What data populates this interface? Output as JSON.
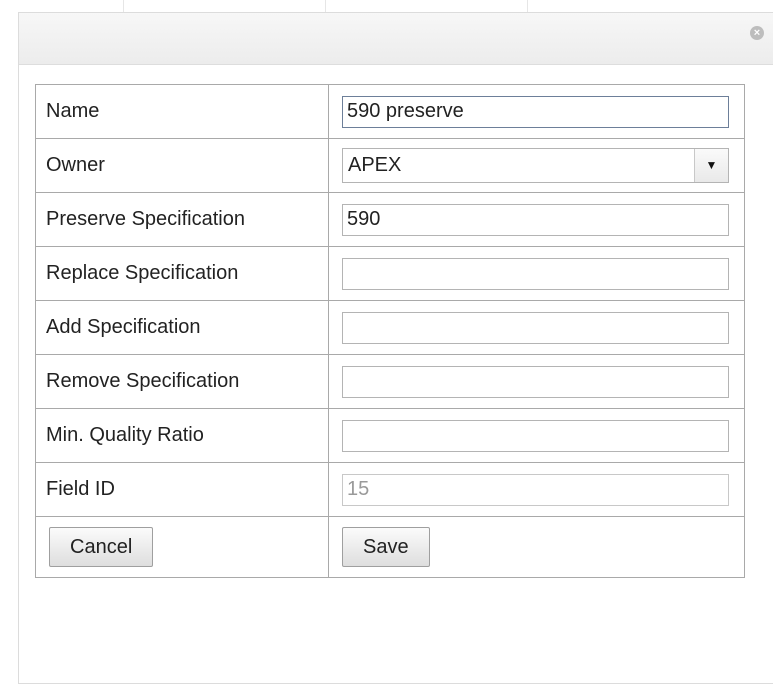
{
  "dialog": {
    "close_icon": "close-icon",
    "close_glyph": "×"
  },
  "form": {
    "fields": [
      {
        "label": "Name",
        "value": "590 preserve",
        "type": "text"
      },
      {
        "label": "Owner",
        "value": "APEX",
        "type": "select"
      },
      {
        "label": "Preserve Specification",
        "value": "590",
        "type": "text"
      },
      {
        "label": "Replace Specification",
        "value": "",
        "type": "text"
      },
      {
        "label": "Add Specification",
        "value": "",
        "type": "text"
      },
      {
        "label": "Remove Specification",
        "value": "",
        "type": "text"
      },
      {
        "label": "Min. Quality Ratio",
        "value": "",
        "type": "text"
      },
      {
        "label": "Field ID",
        "value": "15",
        "type": "disabled"
      }
    ],
    "cancel_label": "Cancel",
    "save_label": "Save"
  }
}
